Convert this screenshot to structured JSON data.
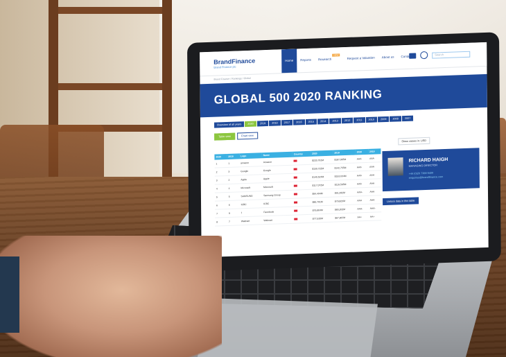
{
  "site": {
    "logo": "BrandFinance",
    "logo_sub": "Brand Finance plc",
    "nav": [
      "Home",
      "Reports",
      "Research",
      "Request a Valuation",
      "About us",
      "Contact us"
    ],
    "nav_badge": "NEW",
    "search_placeholder": "Search",
    "breadcrumb": "Brand Finance / Rankings / Global"
  },
  "hero": {
    "title": "GLOBAL 500 2020 RANKING"
  },
  "filters": [
    "Overview of all years",
    "2020",
    "2019",
    "2018",
    "2017",
    "2016",
    "2015",
    "2014",
    "2013",
    "2012",
    "2011",
    "2010",
    "2009",
    "2008",
    "2007"
  ],
  "actions": {
    "primary": "Table view",
    "secondary": "Chart view"
  },
  "currency": "Show values in: USD",
  "table": {
    "headers": [
      "2020",
      "2019",
      "Logo",
      "Name",
      "Country",
      "2020",
      "2019",
      "2020",
      "2019"
    ],
    "rows": [
      [
        "1",
        "1",
        "amazon",
        "Amazon",
        "$220,791M",
        "$187,905M",
        "AAA",
        "AAA"
      ],
      [
        "2",
        "3",
        "Google",
        "Google",
        "$159,722M",
        "$142,755M",
        "AAA",
        "AAA"
      ],
      [
        "3",
        "2",
        "Apple",
        "Apple",
        "$140,524M",
        "$153,634M",
        "AAA",
        "AAA"
      ],
      [
        "4",
        "4",
        "Microsoft",
        "Microsoft",
        "$117,072M",
        "$119,595M",
        "AAA",
        "AAA"
      ],
      [
        "5",
        "5",
        "SAMSUNG",
        "Samsung Group",
        "$94,494M",
        "$91,282M",
        "AAA-",
        "AAA"
      ],
      [
        "6",
        "6",
        "ICBC",
        "ICBC",
        "$80,791M",
        "$79,823M",
        "AAA",
        "AAA"
      ],
      [
        "7",
        "9",
        "f",
        "Facebook",
        "$79,804M",
        "$83,202M",
        "AAA-",
        "AAA-"
      ],
      [
        "8",
        "7",
        "Walmart",
        "Walmart",
        "$77,520M",
        "$67,867M",
        "AA+",
        "AA+"
      ]
    ]
  },
  "profile": {
    "name": "RICHARD HAIGH",
    "role": "MANAGING DIRECTOR",
    "phone": "+44 (0)20 7389 9400",
    "email": "enquiries@brandfinance.com"
  },
  "unlock": "Unlock data in this table",
  "colors": {
    "brand": "#1f4a9a",
    "accent": "#3ab0e2",
    "green": "#8cc63f"
  }
}
